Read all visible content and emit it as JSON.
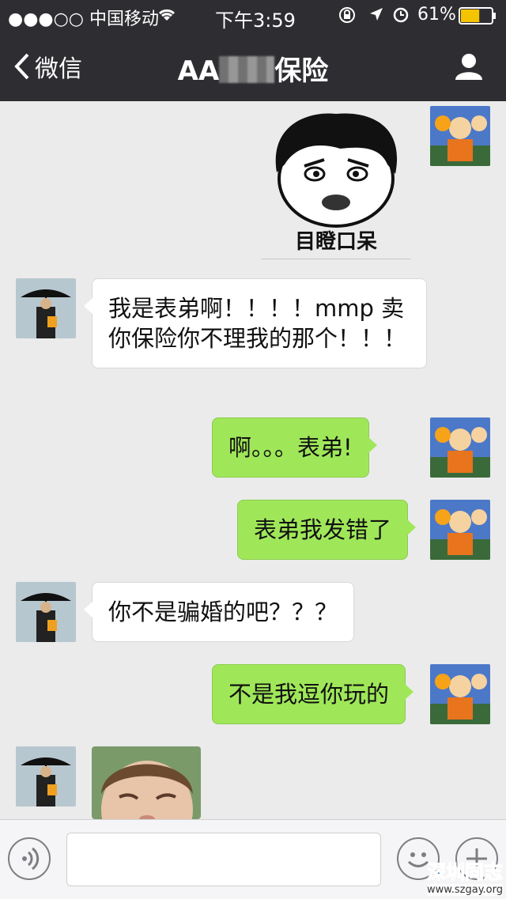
{
  "status_bar": {
    "carrier": "●●●○○ 中国移动",
    "time": "下午3:59",
    "battery_percent": "61%",
    "battery_level": 0.61
  },
  "nav": {
    "back_label": "微信",
    "title_prefix": "AA",
    "title_suffix": "保险"
  },
  "sticker": {
    "caption": "目瞪口呆"
  },
  "messages": [
    {
      "side": "in",
      "text": "我是表弟啊！！！！mmp 卖你保险你不理我的那个！！！"
    },
    {
      "side": "out",
      "text": "啊。。。表弟!"
    },
    {
      "side": "out",
      "text": "表弟我发错了"
    },
    {
      "side": "in",
      "text": "你不是骗婚的吧？？？"
    },
    {
      "side": "out",
      "text": "不是我逗你玩的"
    }
  ],
  "watermark": {
    "main": "深圳同志",
    "sub": "www.szgay.org"
  },
  "colors": {
    "nav_bg": "#2e2e32",
    "chat_bg": "#ebebeb",
    "outgoing_bubble": "#9fe759",
    "incoming_bubble": "#ffffff",
    "battery": "#f5c400"
  }
}
